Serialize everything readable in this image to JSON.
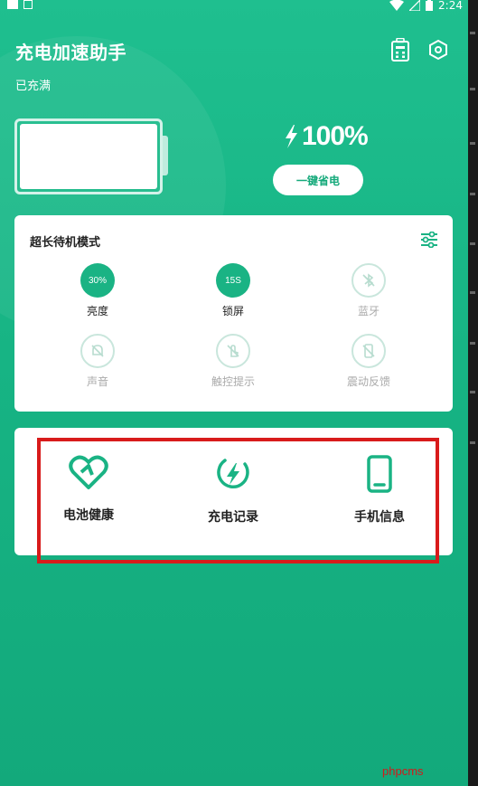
{
  "status_bar": {
    "time": "2:24"
  },
  "header": {
    "title": "充电加速助手",
    "subtitle": "已充满"
  },
  "battery": {
    "level_fraction": 1.0,
    "percent_text": "100%",
    "save_button_label": "一键省电"
  },
  "mode_card": {
    "title": "超长待机模式",
    "items": [
      {
        "label": "亮度",
        "value": "30%",
        "active": true
      },
      {
        "label": "锁屏",
        "value": "15S",
        "active": true
      },
      {
        "label": "蓝牙",
        "icon": "bluetooth-off-icon",
        "active": false
      },
      {
        "label": "声音",
        "icon": "bell-off-icon",
        "active": false
      },
      {
        "label": "触控提示",
        "icon": "touch-off-icon",
        "active": false
      },
      {
        "label": "震动反馈",
        "icon": "vibrate-off-icon",
        "active": false
      }
    ]
  },
  "tools_card": {
    "items": [
      {
        "label": "电池健康",
        "icon": "heart-icon"
      },
      {
        "label": "充电记录",
        "icon": "charge-record-icon"
      },
      {
        "label": "手机信息",
        "icon": "phone-icon"
      }
    ]
  },
  "watermark": "phpcms",
  "colors": {
    "accent": "#1ab384",
    "highlight_box": "#d81b1b"
  }
}
